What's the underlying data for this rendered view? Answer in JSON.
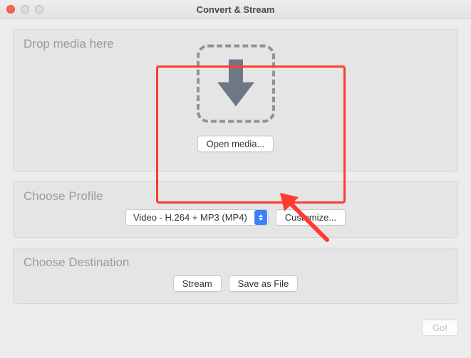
{
  "window": {
    "title": "Convert & Stream"
  },
  "drop": {
    "section_title": "Drop media here",
    "open_button": "Open media..."
  },
  "profile": {
    "section_title": "Choose Profile",
    "selected": "Video - H.264 + MP3 (MP4)",
    "customize_button": "Customize..."
  },
  "destination": {
    "section_title": "Choose Destination",
    "stream_button": "Stream",
    "save_button": "Save as File"
  },
  "footer": {
    "go_button": "Go!"
  }
}
